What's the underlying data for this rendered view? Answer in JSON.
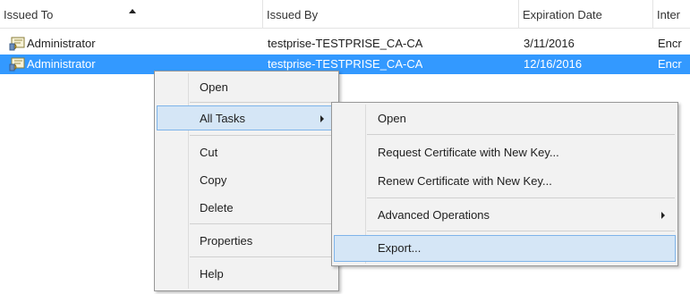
{
  "columns": {
    "issued_to": "Issued To",
    "issued_by": "Issued By",
    "expiration": "Expiration Date",
    "intended": "Inter"
  },
  "rows": [
    {
      "issued_to": "Administrator",
      "issued_by": "testprise-TESTPRISE_CA-CA",
      "expiration": "3/11/2016",
      "intended": "Encr",
      "selected": false
    },
    {
      "issued_to": "Administrator",
      "issued_by": "testprise-TESTPRISE_CA-CA",
      "expiration": "12/16/2016",
      "intended": "Encr",
      "selected": true
    }
  ],
  "context_menu": {
    "open": "Open",
    "all_tasks": "All Tasks",
    "cut": "Cut",
    "copy": "Copy",
    "delete": "Delete",
    "properties": "Properties",
    "help": "Help"
  },
  "submenu": {
    "open": "Open",
    "request_new_key": "Request Certificate with New Key...",
    "renew_new_key": "Renew Certificate with New Key...",
    "advanced_operations": "Advanced Operations",
    "export": "Export..."
  },
  "colors": {
    "selection": "#3399ff",
    "menu_highlight": "#d5e6f6",
    "menu_highlight_border": "#7eb4ea",
    "menu_background": "#f2f2f2"
  },
  "icons": {
    "certificate": "certificate-icon",
    "sort": "sort-ascending-icon",
    "submenu": "submenu-arrow-icon"
  }
}
